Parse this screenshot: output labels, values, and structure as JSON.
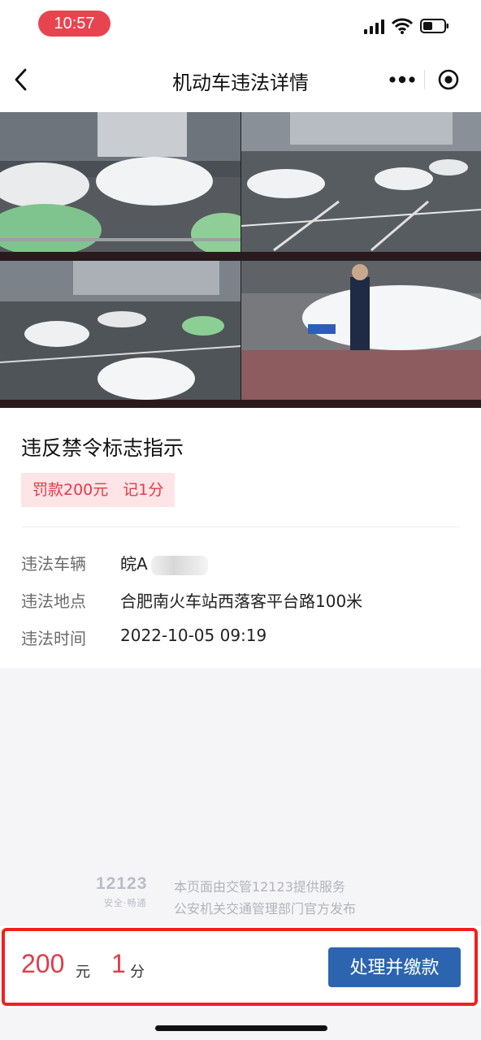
{
  "status_bar": {
    "time": "10:57"
  },
  "nav": {
    "title": "机动车违法详情"
  },
  "icons": {
    "back": "chevron-left-icon",
    "more": "more-dots-icon",
    "target": "target-icon",
    "signal": "signal-icon",
    "wifi": "wifi-icon",
    "battery": "battery-icon"
  },
  "photos": {
    "count": 4
  },
  "violation": {
    "title": "违反禁令标志指示",
    "fine": "罚款200元",
    "points": "记1分",
    "details": [
      {
        "label": "违法车辆",
        "value": "皖A"
      },
      {
        "label": "违法地点",
        "value": "合肥南火车站西落客平台路100米"
      },
      {
        "label": "违法时间",
        "value": "2022-10-05 09:19"
      }
    ]
  },
  "branding": {
    "logo_number": "12123",
    "logo_tagline": "安全·畅通",
    "line1": "本页面由交管12123提供服务",
    "line2": "公安机关交通管理部门官方发布"
  },
  "bottom_bar": {
    "amount": "200",
    "amount_unit": "元",
    "points": "1",
    "points_unit": "分",
    "pay_button": "处理并缴款"
  },
  "colors": {
    "accent_red": "#e03c4a",
    "button_blue": "#2d64b0",
    "highlight_red": "#ef2020",
    "status_pill": "#e8444f"
  }
}
